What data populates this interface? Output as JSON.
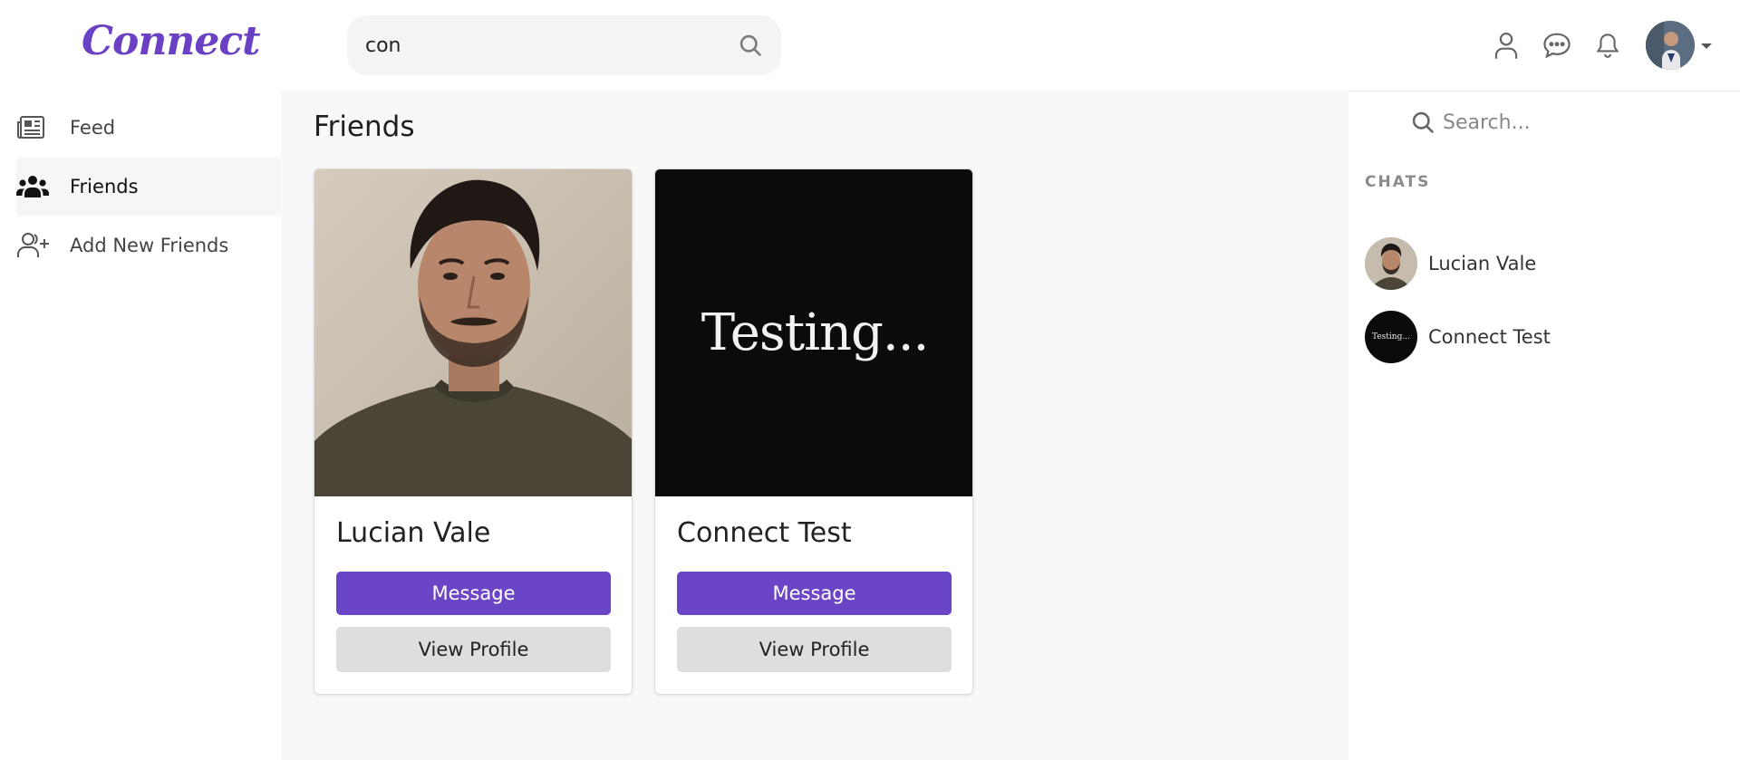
{
  "header": {
    "logo": "Connect",
    "search_value": "con",
    "accent": "#6a45c5"
  },
  "sidebar": {
    "items": [
      {
        "label": "Feed",
        "icon": "newspaper-icon",
        "active": false
      },
      {
        "label": "Friends",
        "icon": "users-icon",
        "active": true
      },
      {
        "label": "Add New Friends",
        "icon": "user-plus-icon",
        "active": false
      }
    ]
  },
  "main": {
    "title": "Friends",
    "cards": [
      {
        "name": "Lucian Vale",
        "message_label": "Message",
        "profile_label": "View Profile",
        "image": "portrait-photo"
      },
      {
        "name": "Connect Test",
        "message_label": "Message",
        "profile_label": "View Profile",
        "image_text": "Testing..."
      }
    ]
  },
  "chat_panel": {
    "search_placeholder": "Search...",
    "heading": "CHATS",
    "chats": [
      {
        "name": "Lucian Vale",
        "avatar": "portrait-photo"
      },
      {
        "name": "Connect Test",
        "avatar_text": "Testing..."
      }
    ]
  }
}
